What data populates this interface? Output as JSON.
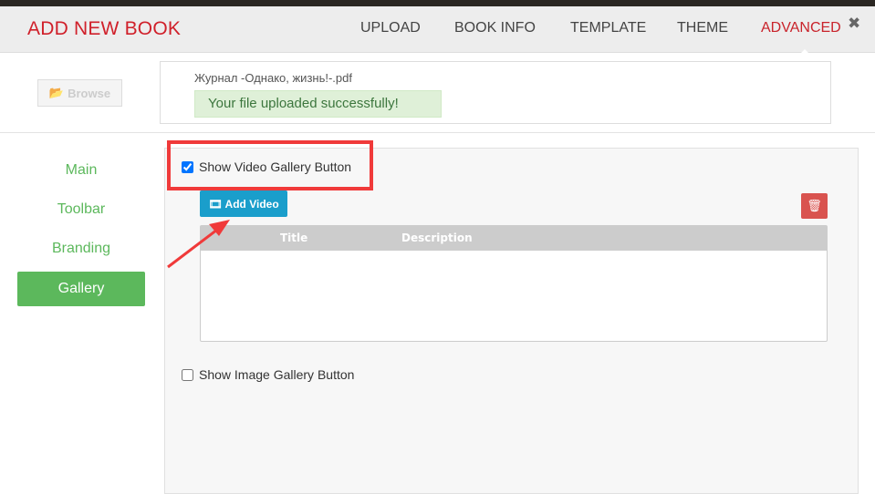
{
  "header": {
    "title": "ADD NEW BOOK",
    "tabs": [
      {
        "label": "UPLOAD"
      },
      {
        "label": "BOOK INFO"
      },
      {
        "label": "TEMPLATE"
      },
      {
        "label": "THEME"
      },
      {
        "label": "ADVANCED"
      }
    ],
    "active_tab": "ADVANCED",
    "close_icon": "close-icon"
  },
  "upload": {
    "browse_label": "Browse",
    "file_name": "Журнал -Однако, жизнь!-.pdf",
    "success_message": "Your file uploaded successfully!"
  },
  "sidebar": {
    "items": [
      {
        "label": "Main"
      },
      {
        "label": "Toolbar"
      },
      {
        "label": "Branding"
      },
      {
        "label": "Gallery"
      }
    ],
    "active": "Gallery"
  },
  "gallery": {
    "video_checkbox_label": "Show Video Gallery Button",
    "video_checked": true,
    "add_video_label": "Add Video",
    "table_headers": [
      "Title",
      "Description"
    ],
    "image_checkbox_label": "Show Image Gallery Button",
    "image_checked": false
  },
  "colors": {
    "accent_red": "#d0202a",
    "green": "#5cb85c",
    "blue": "#1a9ecb",
    "danger": "#d9534f",
    "annotation": "#f03a3a"
  }
}
